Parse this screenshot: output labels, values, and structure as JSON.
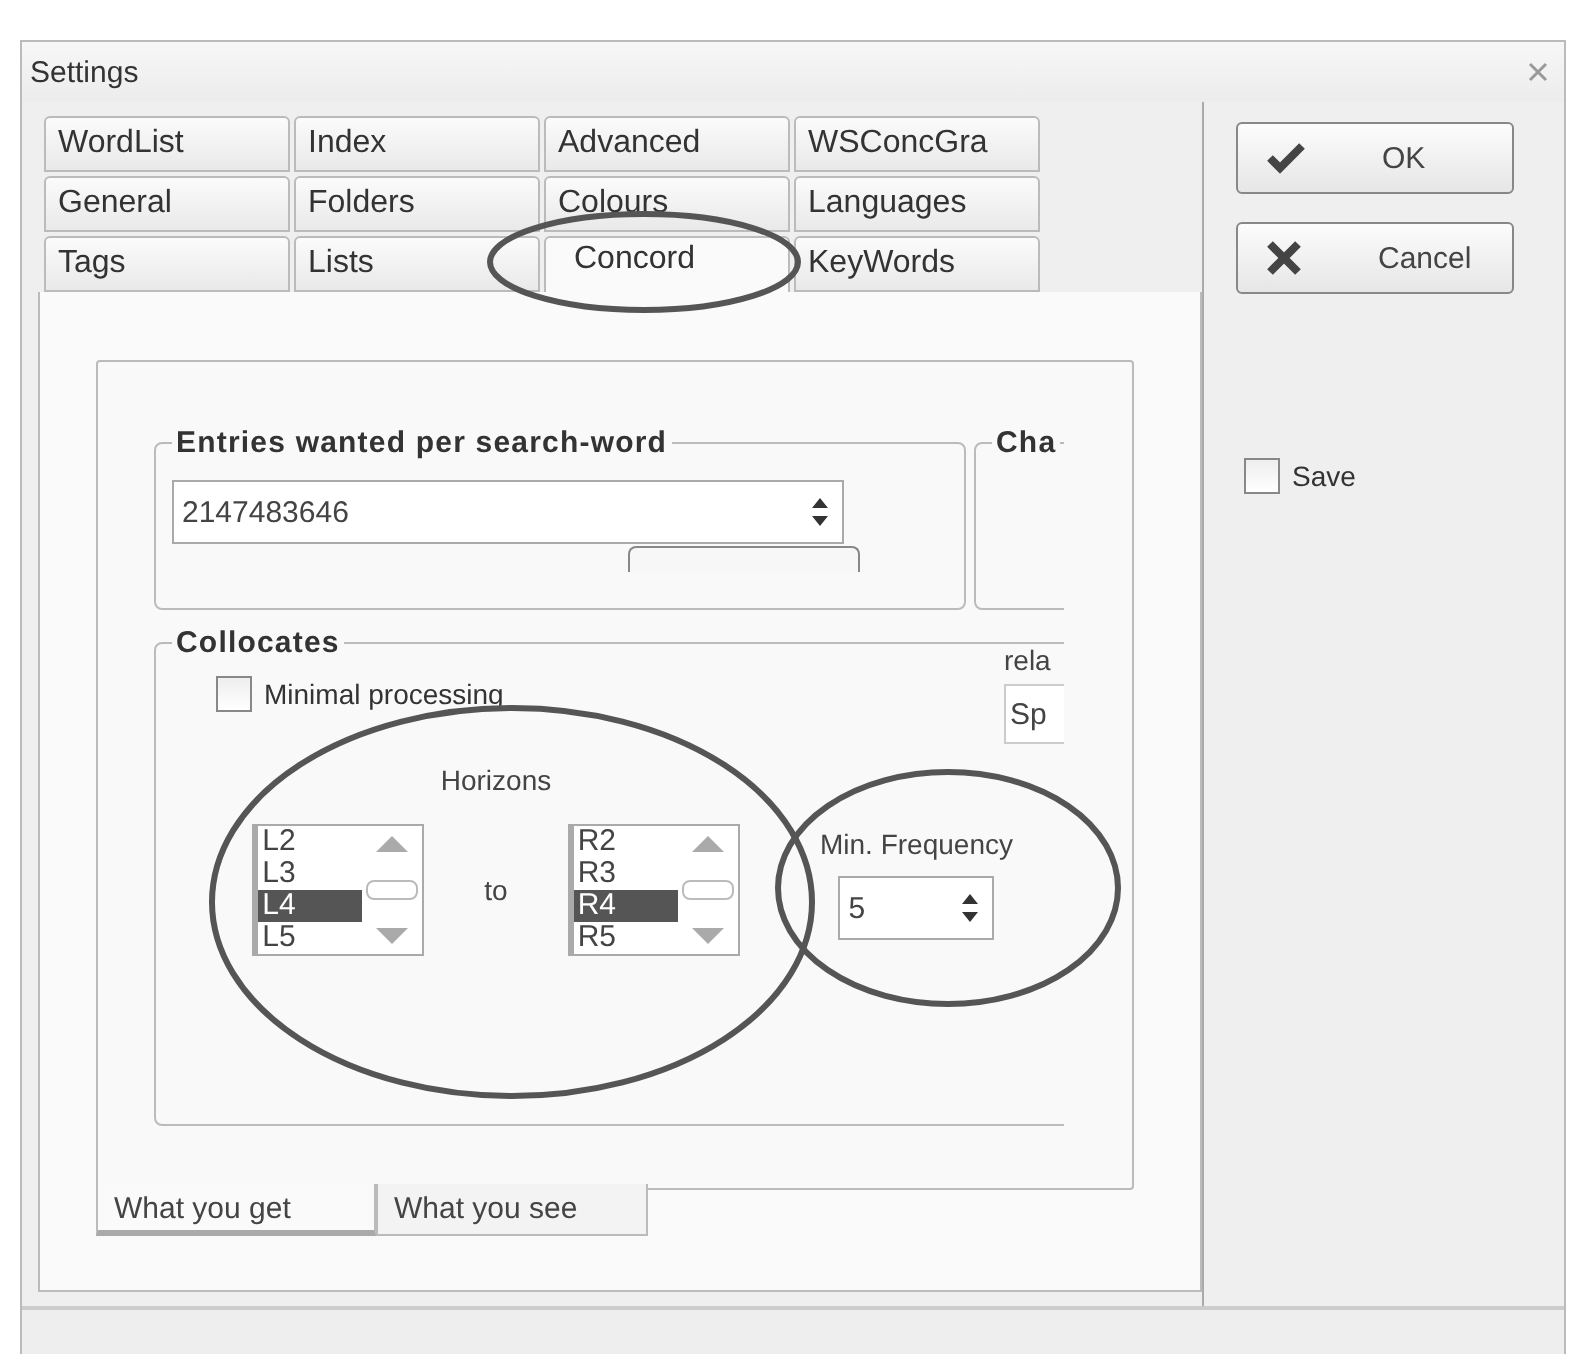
{
  "window": {
    "title": "Settings"
  },
  "tabs": [
    {
      "label": "WordList",
      "selected": false
    },
    {
      "label": "Index",
      "selected": false
    },
    {
      "label": "Advanced",
      "selected": false
    },
    {
      "label": "WSConcGra",
      "selected": false
    },
    {
      "label": "General",
      "selected": false
    },
    {
      "label": "Folders",
      "selected": false
    },
    {
      "label": "Colours",
      "selected": false
    },
    {
      "label": "Languages",
      "selected": false
    },
    {
      "label": "Tags",
      "selected": false
    },
    {
      "label": "Lists",
      "selected": false
    },
    {
      "label": "Concord",
      "selected": true
    },
    {
      "label": "KeyWords",
      "selected": false
    }
  ],
  "buttons": [
    {
      "kind": "ok",
      "label": "OK"
    },
    {
      "kind": "cancel",
      "label": "Cancel"
    }
  ],
  "save": {
    "label": "Save",
    "checked": false
  },
  "entries": {
    "title": "Entries wanted per search-word",
    "value": "2147483646"
  },
  "cha_group": {
    "title": "Cha"
  },
  "collocates": {
    "title": "Collocates",
    "minimal_processing": {
      "label": "Minimal processing",
      "checked": false
    },
    "rela_label": "rela",
    "sp_field": "Sp",
    "horizons": {
      "label": "Horizons",
      "to": "to",
      "left": [
        {
          "label": "L2",
          "selected": false
        },
        {
          "label": "L3",
          "selected": false
        },
        {
          "label": "L4",
          "selected": true
        },
        {
          "label": "L5",
          "selected": false
        }
      ],
      "right": [
        {
          "label": "R2",
          "selected": false
        },
        {
          "label": "R3",
          "selected": false
        },
        {
          "label": "R4",
          "selected": true
        },
        {
          "label": "R5",
          "selected": false
        }
      ]
    },
    "min_frequency": {
      "label": "Min. Frequency",
      "value": "5"
    }
  },
  "bottom_tabs": [
    {
      "label": "What you get",
      "selected": true
    },
    {
      "label": "What you see",
      "selected": false
    }
  ]
}
